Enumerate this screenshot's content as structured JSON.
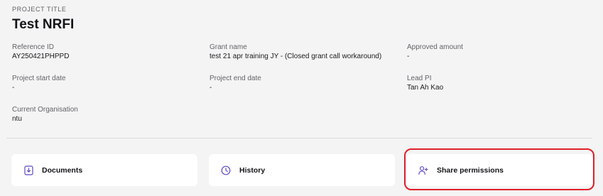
{
  "header": {
    "section_label": "PROJECT TITLE",
    "title": "Test NRFI"
  },
  "fields": {
    "reference_id": {
      "label": "Reference ID",
      "value": "AY250421PHPPD"
    },
    "grant_name": {
      "label": "Grant name",
      "value": "test 21 apr training JY - (Closed grant call workaround)"
    },
    "approved_amount": {
      "label": "Approved amount",
      "value": "-"
    },
    "start_date": {
      "label": "Project start date",
      "value": "-"
    },
    "end_date": {
      "label": "Project end date",
      "value": "-"
    },
    "lead_pi": {
      "label": "Lead PI",
      "value": "Tan Ah Kao"
    },
    "current_org": {
      "label": "Current Organisation",
      "value": "ntu"
    }
  },
  "actions": {
    "documents": {
      "label": "Documents",
      "icon": "document-download-icon"
    },
    "history": {
      "label": "History",
      "icon": "clock-icon"
    },
    "share": {
      "label": "Share permissions",
      "icon": "user-add-icon"
    }
  },
  "colors": {
    "icon_accent": "#5b4bc4",
    "highlight": "#e0202a",
    "background": "#f4f4f4"
  }
}
